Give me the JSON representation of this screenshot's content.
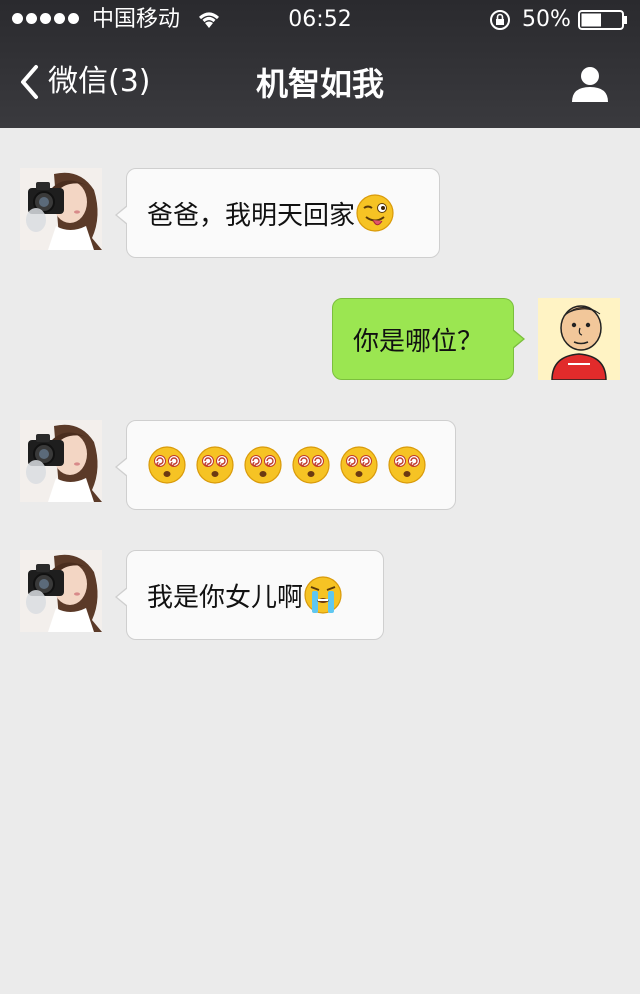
{
  "status_bar": {
    "carrier": "中国移动",
    "time": "06:52",
    "battery_percent": "50%",
    "battery_level": 0.5,
    "signal_bars": 5
  },
  "nav": {
    "back_label": "微信(3)",
    "title": "机智如我"
  },
  "messages": [
    {
      "sender": "contact",
      "text": "爸爸，我明天回家",
      "emojis": [
        "winking-tongue-emoji"
      ]
    },
    {
      "sender": "me",
      "text": "你是哪位？",
      "emojis": []
    },
    {
      "sender": "contact",
      "text": "",
      "emojis": [
        "dizzy-face-emoji",
        "dizzy-face-emoji",
        "dizzy-face-emoji",
        "dizzy-face-emoji",
        "dizzy-face-emoji",
        "dizzy-face-emoji"
      ]
    },
    {
      "sender": "contact",
      "text": "我是你女儿啊",
      "emojis": [
        "crying-face-emoji"
      ]
    }
  ],
  "colors": {
    "nav_background": "#2f2f33",
    "chat_background": "#ebebeb",
    "incoming_bubble": "#fafafa",
    "outgoing_bubble": "#9be651"
  }
}
